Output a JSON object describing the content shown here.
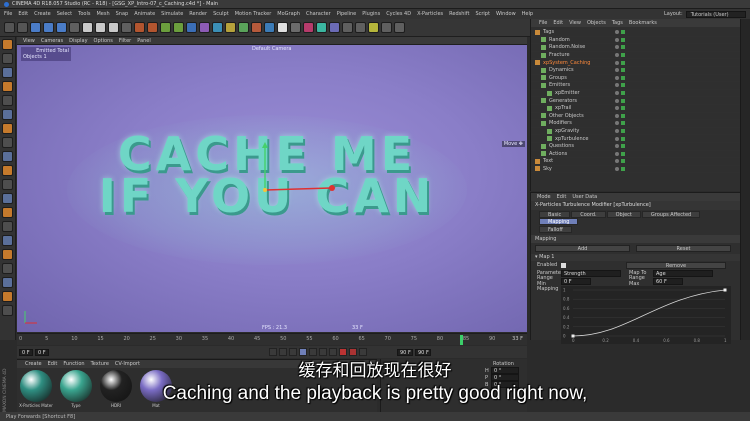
{
  "window": {
    "title": "CINEMA 4D R18.057 Studio (RC - R18) - [GSG_XP_Intro-07_c_Caching.c4d *] - Main"
  },
  "menu": [
    "File",
    "Edit",
    "Create",
    "Select",
    "Tools",
    "Mesh",
    "Snap",
    "Animate",
    "Simulate",
    "Render",
    "Sculpt",
    "Motion Tracker",
    "MoGraph",
    "Character",
    "Pipeline",
    "Plugins",
    "Cycles 4D",
    "X-Particles",
    "Redshift",
    "Script",
    "Window",
    "Help"
  ],
  "layout": {
    "label": "Layout:",
    "value": "Tutorials (User)"
  },
  "viewport": {
    "menu": [
      "View",
      "Cameras",
      "Display",
      "Options",
      "Filter",
      "Panel"
    ],
    "hud_title": "Emitted Total",
    "hud_stats": "Objects  1",
    "camera_label": "Default Camera",
    "headline_line1": "CACHE ME",
    "headline_line2": "IF YOU CAN",
    "fps": "FPS : 21.3",
    "frame_readout": "33 F",
    "move_label": "Move ✥"
  },
  "object_manager": {
    "menu": [
      "File",
      "Edit",
      "View",
      "Objects",
      "Tags",
      "Bookmarks"
    ],
    "items": [
      {
        "label": "Tags",
        "indent": 0
      },
      {
        "label": "Random",
        "indent": 1
      },
      {
        "label": "Random.Noise",
        "indent": 1
      },
      {
        "label": "Fracture",
        "indent": 1
      },
      {
        "label": "xpSystem_Caching",
        "indent": 0
      },
      {
        "label": "Dynamics",
        "indent": 1
      },
      {
        "label": "Groups",
        "indent": 1
      },
      {
        "label": "Emitters",
        "indent": 1
      },
      {
        "label": "xpEmitter",
        "indent": 2
      },
      {
        "label": "Generators",
        "indent": 1
      },
      {
        "label": "xpTrail",
        "indent": 2
      },
      {
        "label": "Other Objects",
        "indent": 1
      },
      {
        "label": "Modifiers",
        "indent": 1
      },
      {
        "label": "xpGravity",
        "indent": 2
      },
      {
        "label": "xpTurbulence",
        "indent": 2
      },
      {
        "label": "Questions",
        "indent": 1
      },
      {
        "label": "Actions",
        "indent": 1
      },
      {
        "label": "Text",
        "indent": 0
      },
      {
        "label": "Sky",
        "indent": 0
      }
    ]
  },
  "attributes": {
    "menu": [
      "Mode",
      "Edit",
      "User Data"
    ],
    "object_title": "X-Particles Turbulence Modifier [xpTurbulence]",
    "tabs": [
      "Basic",
      "Coord.",
      "Object",
      "Groups Affected",
      "Mapping"
    ],
    "tab_falloff": "Falloff",
    "section": "Mapping",
    "add_label": "Add",
    "reset_label": "Reset",
    "map_header": "▾ Map 1",
    "enabled_label": "Enabled",
    "remove_label": "Remove",
    "parameter_label": "Parameter",
    "parameter_value": "Strength",
    "map_to_label": "Map To",
    "map_to_value": "Age",
    "range_min_label": "Range Min",
    "range_min_value": "0 F",
    "range_max_label": "Range Max",
    "range_max_value": "60 F",
    "graph_label": "Mapping",
    "graph_yticks": [
      "1",
      "0.8",
      "0.6",
      "0.4",
      "0.2",
      "0"
    ],
    "graph_xticks": [
      "0",
      "0.2",
      "0.4",
      "0.6",
      "0.8",
      "1"
    ]
  },
  "timeline": {
    "ticks": [
      "0",
      "5",
      "10",
      "15",
      "20",
      "25",
      "30",
      "35",
      "40",
      "45",
      "50",
      "55",
      "60",
      "65",
      "70",
      "75",
      "80",
      "85",
      "90"
    ],
    "start_field": "0 F",
    "start_field2": "0 F",
    "end_field": "90 F",
    "end_field2": "90 F",
    "current_frame": "33 F"
  },
  "material_manager": {
    "menu": [
      "Create",
      "Edit",
      "Function",
      "Texture",
      "CV-Import"
    ],
    "materials": [
      {
        "label": "X-Particles Mater",
        "color": "#2f8f82"
      },
      {
        "label": "Type",
        "color": "#3aa58f"
      },
      {
        "label": "HDRI",
        "color": "#222222"
      },
      {
        "label": "Mat",
        "color": "#7a6cc4"
      }
    ],
    "side_label": "MAXON CINEMA 4D"
  },
  "coordinates": {
    "header": "Rotation",
    "rows": [
      {
        "label": "H",
        "value": "0 °"
      },
      {
        "label": "P",
        "value": "0 °"
      },
      {
        "label": "B",
        "value": "0 °"
      }
    ]
  },
  "status": {
    "text": "Play Forwards [Shortcut F8]"
  },
  "subtitle": {
    "zh": "缓存和回放现在很好",
    "en": "Caching and the playback is pretty good right now,"
  },
  "colors": {
    "viewport_bg": "#8a7ec8",
    "text_fill": "#6fd6c6",
    "accent": "#6f7fb8",
    "object_selected": "#ff8a3c"
  }
}
